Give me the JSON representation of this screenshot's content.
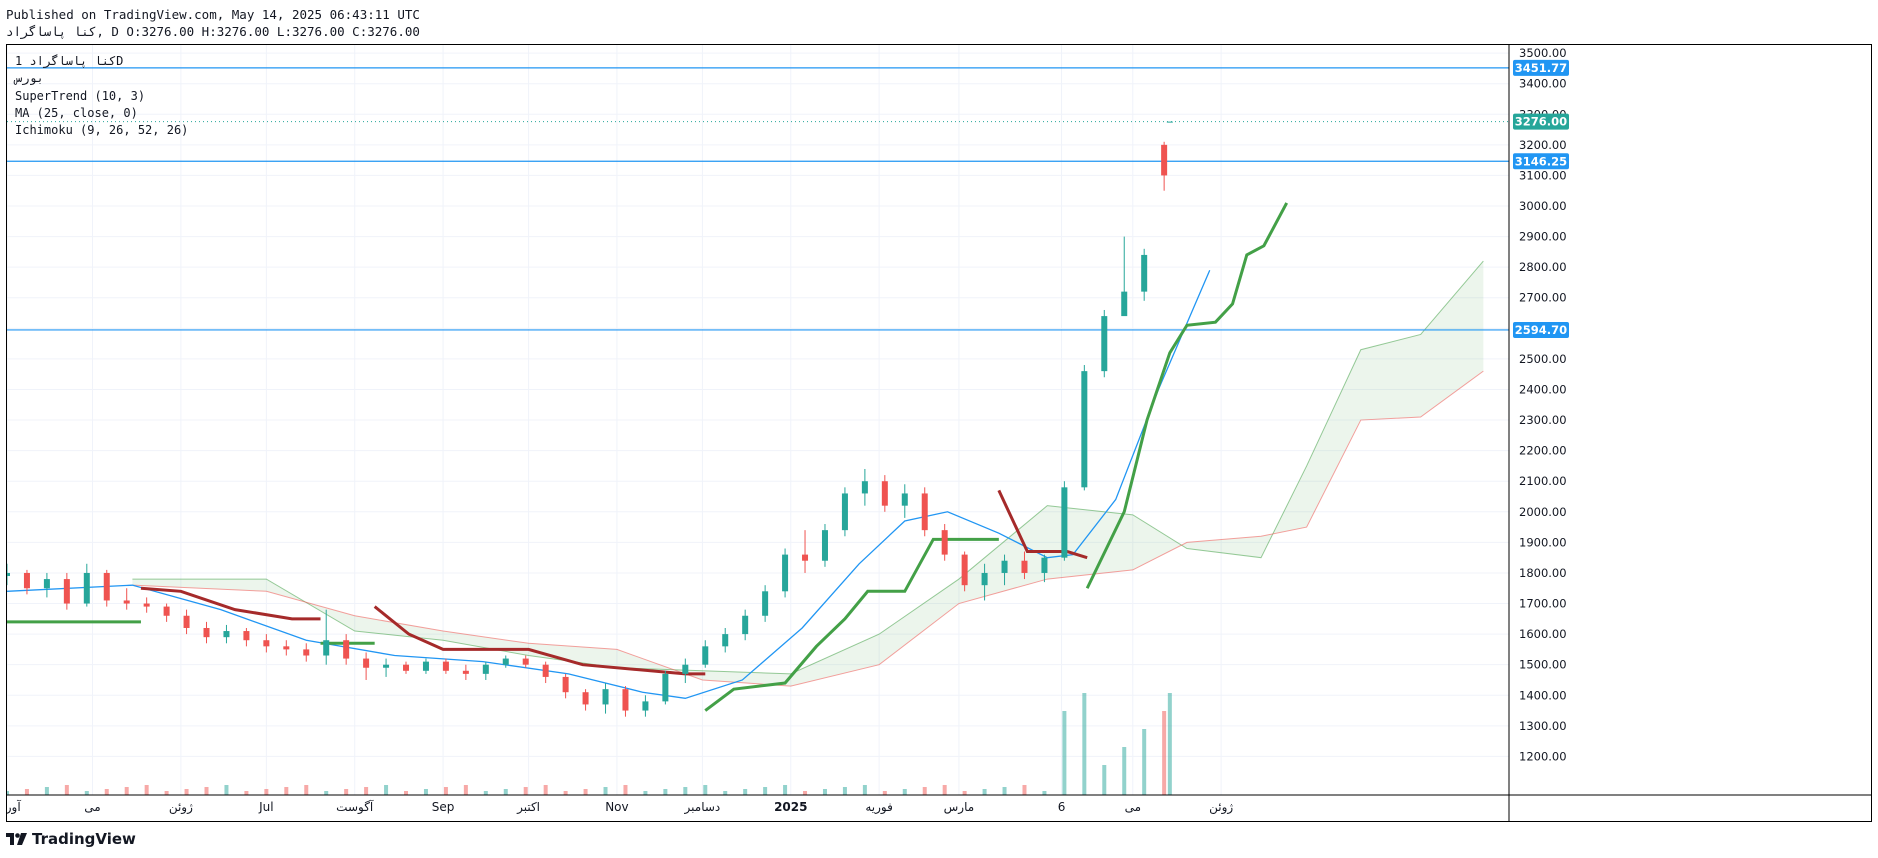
{
  "header": {
    "published_line": "Published on TradingView.com, May 14, 2025 06:43:11 UTC",
    "ohlc_line": "کنا پاساگراد, D O:3276.00 H:3276.00 L:3276.00 C:3276.00"
  },
  "legend": {
    "symbol_line": "کنا پاساگراد 1D",
    "exchange_line": "بورس",
    "indicators": [
      "SuperTrend (10, 3)",
      "MA (25, close, 0)",
      "Ichimoku (9, 26, 52, 26)"
    ]
  },
  "footer": {
    "brand": "TradingView",
    "logo_icon": "tradingview-logo-icon"
  },
  "colors": {
    "up": "#26a69a",
    "down": "#ef5350",
    "supertrend_up": "#43a047",
    "supertrend_down": "#a52a2a",
    "ma": "#2196f3",
    "hline": "#2196f3",
    "last_price": "#26a69a"
  },
  "chart_data": {
    "type": "candlestick",
    "y_axis_ticks": [
      1200,
      1300,
      1400,
      1500,
      1600,
      1700,
      1800,
      1900,
      2000,
      2100,
      2200,
      2300,
      2400,
      2500,
      2600,
      2700,
      2800,
      2900,
      3000,
      3100,
      3200,
      3300,
      3400,
      3500
    ],
    "y_axis_tick_labels": [
      "1200.00",
      "1300.00",
      "1400.00",
      "1500.00",
      "1600.00",
      "1700.00",
      "1800.00",
      "1900.00",
      "2000.00",
      "2100.00",
      "2200.00",
      "2300.00",
      "2400.00",
      "2500.00",
      "2600.00",
      "2700.00",
      "2800.00",
      "2900.00",
      "3000.00",
      "3100.00",
      "3200.00",
      "3300.00",
      "3400.00",
      "3500.00"
    ],
    "ylim": [
      1100,
      3520
    ],
    "x_axis_labels": [
      "آوریل",
      "می",
      "ژوئن",
      "Jul",
      "آگوست",
      "Sep",
      "اکتبر",
      "Nov",
      "دسامبر",
      "2025",
      "فوریه",
      "مارس",
      "6",
      "می",
      "ژوئن"
    ],
    "x_label_dates": [
      "2024-04-01",
      "2024-05-01",
      "2024-06-01",
      "2024-07-01",
      "2024-08-01",
      "2024-09-01",
      "2024-10-01",
      "2024-11-01",
      "2024-12-01",
      "2025-01-01",
      "2025-02-01",
      "2025-03-01",
      "2025-04-06",
      "2025-05-01",
      "2025-06-01"
    ],
    "horizontal_lines": [
      {
        "value": 3451.77,
        "label": "3451.77",
        "style": "solid"
      },
      {
        "value": 3146.25,
        "label": "3146.25",
        "style": "solid"
      },
      {
        "value": 2594.7,
        "label": "2594.70",
        "style": "solid"
      }
    ],
    "last_price": {
      "value": 3276.0,
      "label": "3276.00"
    },
    "candles": [
      {
        "date": "2024-04-01",
        "o": 1790,
        "h": 1830,
        "l": 1760,
        "c": 1800
      },
      {
        "date": "2024-04-08",
        "o": 1800,
        "h": 1810,
        "l": 1730,
        "c": 1750
      },
      {
        "date": "2024-04-15",
        "o": 1750,
        "h": 1800,
        "l": 1720,
        "c": 1780
      },
      {
        "date": "2024-04-22",
        "o": 1780,
        "h": 1800,
        "l": 1680,
        "c": 1700
      },
      {
        "date": "2024-04-29",
        "o": 1700,
        "h": 1830,
        "l": 1690,
        "c": 1800
      },
      {
        "date": "2024-05-06",
        "o": 1800,
        "h": 1810,
        "l": 1690,
        "c": 1710
      },
      {
        "date": "2024-05-13",
        "o": 1710,
        "h": 1750,
        "l": 1680,
        "c": 1700
      },
      {
        "date": "2024-05-20",
        "o": 1700,
        "h": 1720,
        "l": 1670,
        "c": 1690
      },
      {
        "date": "2024-05-27",
        "o": 1690,
        "h": 1700,
        "l": 1640,
        "c": 1660
      },
      {
        "date": "2024-06-03",
        "o": 1660,
        "h": 1680,
        "l": 1600,
        "c": 1620
      },
      {
        "date": "2024-06-10",
        "o": 1620,
        "h": 1640,
        "l": 1570,
        "c": 1590
      },
      {
        "date": "2024-06-17",
        "o": 1590,
        "h": 1630,
        "l": 1570,
        "c": 1610
      },
      {
        "date": "2024-06-24",
        "o": 1610,
        "h": 1620,
        "l": 1560,
        "c": 1580
      },
      {
        "date": "2024-07-01",
        "o": 1580,
        "h": 1600,
        "l": 1540,
        "c": 1560
      },
      {
        "date": "2024-07-08",
        "o": 1560,
        "h": 1580,
        "l": 1530,
        "c": 1550
      },
      {
        "date": "2024-07-15",
        "o": 1550,
        "h": 1570,
        "l": 1510,
        "c": 1530
      },
      {
        "date": "2024-07-22",
        "o": 1530,
        "h": 1680,
        "l": 1500,
        "c": 1580
      },
      {
        "date": "2024-07-29",
        "o": 1580,
        "h": 1600,
        "l": 1500,
        "c": 1520
      },
      {
        "date": "2024-08-05",
        "o": 1520,
        "h": 1540,
        "l": 1450,
        "c": 1490
      },
      {
        "date": "2024-08-12",
        "o": 1490,
        "h": 1520,
        "l": 1460,
        "c": 1500
      },
      {
        "date": "2024-08-19",
        "o": 1500,
        "h": 1510,
        "l": 1470,
        "c": 1480
      },
      {
        "date": "2024-08-26",
        "o": 1480,
        "h": 1520,
        "l": 1470,
        "c": 1510
      },
      {
        "date": "2024-09-02",
        "o": 1510,
        "h": 1520,
        "l": 1470,
        "c": 1480
      },
      {
        "date": "2024-09-09",
        "o": 1480,
        "h": 1500,
        "l": 1450,
        "c": 1470
      },
      {
        "date": "2024-09-16",
        "o": 1470,
        "h": 1510,
        "l": 1450,
        "c": 1500
      },
      {
        "date": "2024-09-23",
        "o": 1500,
        "h": 1530,
        "l": 1490,
        "c": 1520
      },
      {
        "date": "2024-09-30",
        "o": 1520,
        "h": 1530,
        "l": 1490,
        "c": 1500
      },
      {
        "date": "2024-10-07",
        "o": 1500,
        "h": 1510,
        "l": 1440,
        "c": 1460
      },
      {
        "date": "2024-10-14",
        "o": 1460,
        "h": 1470,
        "l": 1390,
        "c": 1410
      },
      {
        "date": "2024-10-21",
        "o": 1410,
        "h": 1420,
        "l": 1350,
        "c": 1370
      },
      {
        "date": "2024-10-28",
        "o": 1370,
        "h": 1440,
        "l": 1340,
        "c": 1420
      },
      {
        "date": "2024-11-04",
        "o": 1420,
        "h": 1430,
        "l": 1330,
        "c": 1350
      },
      {
        "date": "2024-11-11",
        "o": 1350,
        "h": 1400,
        "l": 1330,
        "c": 1380
      },
      {
        "date": "2024-11-18",
        "o": 1380,
        "h": 1480,
        "l": 1370,
        "c": 1470
      },
      {
        "date": "2024-11-25",
        "o": 1470,
        "h": 1520,
        "l": 1440,
        "c": 1500
      },
      {
        "date": "2024-12-02",
        "o": 1500,
        "h": 1580,
        "l": 1490,
        "c": 1560
      },
      {
        "date": "2024-12-09",
        "o": 1560,
        "h": 1620,
        "l": 1540,
        "c": 1600
      },
      {
        "date": "2024-12-16",
        "o": 1600,
        "h": 1680,
        "l": 1580,
        "c": 1660
      },
      {
        "date": "2024-12-23",
        "o": 1660,
        "h": 1760,
        "l": 1640,
        "c": 1740
      },
      {
        "date": "2024-12-30",
        "o": 1740,
        "h": 1880,
        "l": 1720,
        "c": 1860
      },
      {
        "date": "2025-01-06",
        "o": 1860,
        "h": 1940,
        "l": 1800,
        "c": 1840
      },
      {
        "date": "2025-01-13",
        "o": 1840,
        "h": 1960,
        "l": 1820,
        "c": 1940
      },
      {
        "date": "2025-01-20",
        "o": 1940,
        "h": 2080,
        "l": 1920,
        "c": 2060
      },
      {
        "date": "2025-01-27",
        "o": 2060,
        "h": 2140,
        "l": 2020,
        "c": 2100
      },
      {
        "date": "2025-02-03",
        "o": 2100,
        "h": 2120,
        "l": 2000,
        "c": 2020
      },
      {
        "date": "2025-02-10",
        "o": 2020,
        "h": 2090,
        "l": 1980,
        "c": 2060
      },
      {
        "date": "2025-02-17",
        "o": 2060,
        "h": 2080,
        "l": 1920,
        "c": 1940
      },
      {
        "date": "2025-02-24",
        "o": 1940,
        "h": 1960,
        "l": 1840,
        "c": 1860
      },
      {
        "date": "2025-03-03",
        "o": 1860,
        "h": 1870,
        "l": 1740,
        "c": 1760
      },
      {
        "date": "2025-03-10",
        "o": 1760,
        "h": 1830,
        "l": 1710,
        "c": 1800
      },
      {
        "date": "2025-03-17",
        "o": 1800,
        "h": 1860,
        "l": 1760,
        "c": 1840
      },
      {
        "date": "2025-03-24",
        "o": 1840,
        "h": 1870,
        "l": 1780,
        "c": 1800
      },
      {
        "date": "2025-03-31",
        "o": 1800,
        "h": 1860,
        "l": 1770,
        "c": 1850
      },
      {
        "date": "2025-04-07",
        "o": 1850,
        "h": 2100,
        "l": 1840,
        "c": 2080
      },
      {
        "date": "2025-04-14",
        "o": 2080,
        "h": 2480,
        "l": 2070,
        "c": 2460
      },
      {
        "date": "2025-04-21",
        "o": 2460,
        "h": 2660,
        "l": 2440,
        "c": 2640
      },
      {
        "date": "2025-04-28",
        "o": 2640,
        "h": 2900,
        "l": 2690,
        "c": 2720
      },
      {
        "date": "2025-05-05",
        "o": 2720,
        "h": 2860,
        "l": 2690,
        "c": 2840
      },
      {
        "date": "2025-05-12",
        "o": 3200,
        "h": 3210,
        "l": 3050,
        "c": 3100
      },
      {
        "date": "2025-05-14",
        "o": 3276,
        "h": 3276,
        "l": 3276,
        "c": 3276
      }
    ],
    "series": [
      {
        "name": "MA (25, close, 0)",
        "points": [
          [
            "2024-04-01",
            1740
          ],
          [
            "2024-05-15",
            1760
          ],
          [
            "2024-06-15",
            1680
          ],
          [
            "2024-07-15",
            1580
          ],
          [
            "2024-08-15",
            1530
          ],
          [
            "2024-09-15",
            1510
          ],
          [
            "2024-10-15",
            1470
          ],
          [
            "2024-11-10",
            1410
          ],
          [
            "2024-11-25",
            1390
          ],
          [
            "2024-12-15",
            1450
          ],
          [
            "2025-01-05",
            1620
          ],
          [
            "2025-01-25",
            1830
          ],
          [
            "2025-02-10",
            1970
          ],
          [
            "2025-02-25",
            2000
          ],
          [
            "2025-03-15",
            1930
          ],
          [
            "2025-04-01",
            1850
          ],
          [
            "2025-04-10",
            1860
          ],
          [
            "2025-04-25",
            2040
          ],
          [
            "2025-05-10",
            2400
          ],
          [
            "2025-05-28",
            2790
          ]
        ]
      },
      {
        "name": "SuperTrend (10, 3)",
        "segments": [
          {
            "trend": "up",
            "points": [
              [
                "2024-04-01",
                1640
              ],
              [
                "2024-05-18",
                1640
              ]
            ]
          },
          {
            "trend": "down",
            "points": [
              [
                "2024-05-18",
                1750
              ],
              [
                "2024-06-01",
                1740
              ],
              [
                "2024-06-20",
                1680
              ],
              [
                "2024-07-10",
                1650
              ],
              [
                "2024-07-20",
                1650
              ]
            ]
          },
          {
            "trend": "up",
            "points": [
              [
                "2024-07-20",
                1570
              ],
              [
                "2024-08-08",
                1570
              ]
            ]
          },
          {
            "trend": "down",
            "points": [
              [
                "2024-08-08",
                1690
              ],
              [
                "2024-08-20",
                1600
              ],
              [
                "2024-09-01",
                1550
              ],
              [
                "2024-10-01",
                1550
              ],
              [
                "2024-10-20",
                1500
              ],
              [
                "2024-11-25",
                1470
              ],
              [
                "2024-12-02",
                1470
              ]
            ]
          },
          {
            "trend": "up",
            "points": [
              [
                "2024-12-02",
                1350
              ],
              [
                "2024-12-12",
                1420
              ],
              [
                "2024-12-30",
                1440
              ],
              [
                "2025-01-10",
                1560
              ],
              [
                "2025-01-20",
                1650
              ],
              [
                "2025-01-28",
                1740
              ],
              [
                "2025-02-10",
                1740
              ],
              [
                "2025-02-20",
                1910
              ],
              [
                "2025-03-10",
                1910
              ],
              [
                "2025-03-15",
                1910
              ]
            ]
          },
          {
            "trend": "down",
            "points": [
              [
                "2025-03-15",
                2070
              ],
              [
                "2025-03-25",
                1870
              ],
              [
                "2025-04-08",
                1870
              ],
              [
                "2025-04-15",
                1850
              ]
            ]
          },
          {
            "trend": "up",
            "points": [
              [
                "2025-04-15",
                1750
              ],
              [
                "2025-04-28",
                2000
              ],
              [
                "2025-05-06",
                2300
              ],
              [
                "2025-05-14",
                2520
              ],
              [
                "2025-05-20",
                2610
              ],
              [
                "2025-05-30",
                2620
              ],
              [
                "2025-06-05",
                2680
              ],
              [
                "2025-06-10",
                2840
              ],
              [
                "2025-06-16",
                2870
              ],
              [
                "2025-06-24",
                3010
              ]
            ]
          }
        ]
      },
      {
        "name": "Ichimoku Senkou A",
        "points": [
          [
            "2024-05-15",
            1780
          ],
          [
            "2024-07-01",
            1780
          ],
          [
            "2024-08-01",
            1610
          ],
          [
            "2024-09-01",
            1580
          ],
          [
            "2024-10-01",
            1530
          ],
          [
            "2024-11-01",
            1490
          ],
          [
            "2024-12-01",
            1480
          ],
          [
            "2025-01-01",
            1470
          ],
          [
            "2025-02-01",
            1600
          ],
          [
            "2025-03-01",
            1780
          ],
          [
            "2025-04-01",
            2020
          ],
          [
            "2025-05-01",
            1990
          ],
          [
            "2025-05-20",
            1880
          ],
          [
            "2025-06-15",
            1850
          ],
          [
            "2025-07-01",
            2150
          ],
          [
            "2025-07-20",
            2530
          ],
          [
            "2025-08-10",
            2580
          ],
          [
            "2025-09-01",
            2820
          ]
        ]
      },
      {
        "name": "Ichimoku Senkou B",
        "points": [
          [
            "2024-05-15",
            1760
          ],
          [
            "2024-07-01",
            1740
          ],
          [
            "2024-08-01",
            1660
          ],
          [
            "2024-09-01",
            1610
          ],
          [
            "2024-10-01",
            1570
          ],
          [
            "2024-11-01",
            1550
          ],
          [
            "2024-12-01",
            1450
          ],
          [
            "2025-01-01",
            1430
          ],
          [
            "2025-02-01",
            1500
          ],
          [
            "2025-03-01",
            1700
          ],
          [
            "2025-04-01",
            1780
          ],
          [
            "2025-05-01",
            1810
          ],
          [
            "2025-05-20",
            1900
          ],
          [
            "2025-06-15",
            1920
          ],
          [
            "2025-07-01",
            1950
          ],
          [
            "2025-07-20",
            2300
          ],
          [
            "2025-08-10",
            2310
          ],
          [
            "2025-09-01",
            2460
          ]
        ]
      }
    ]
  }
}
